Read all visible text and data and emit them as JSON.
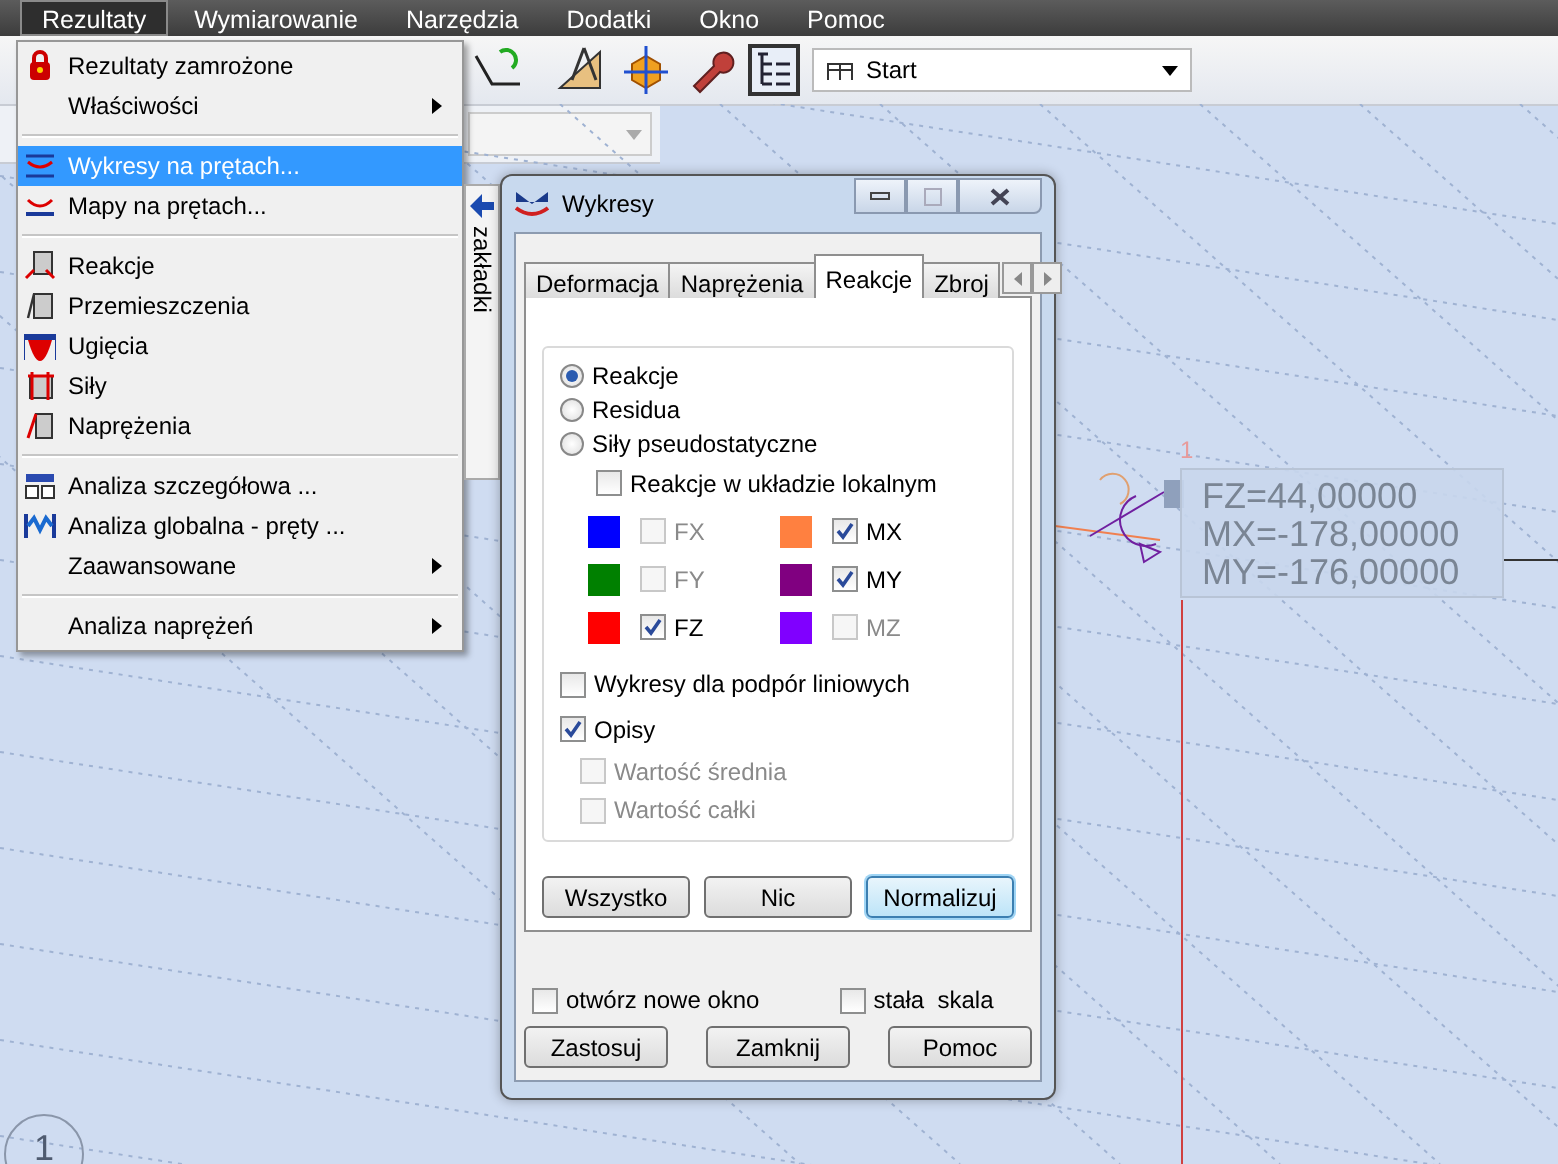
{
  "menu_bar": [
    {
      "label": "Rezultaty",
      "selected": true
    },
    {
      "label": "Wymiarowanie",
      "selected": false
    },
    {
      "label": "Narzędzia",
      "selected": false
    },
    {
      "label": "Dodatki",
      "selected": false
    },
    {
      "label": "Okno",
      "selected": false
    },
    {
      "label": "Pomoc",
      "selected": false
    }
  ],
  "toolbar": {
    "view_dropdown": {
      "value": "Start"
    }
  },
  "dropdown_menu": {
    "items": [
      {
        "kind": "item",
        "label": "Rezultaty zamrożone",
        "submenu": false,
        "selected": false
      },
      {
        "kind": "item",
        "label": "Właściwości",
        "submenu": true,
        "selected": false
      },
      {
        "kind": "separator"
      },
      {
        "kind": "item",
        "label": "Wykresy na prętach...",
        "submenu": false,
        "selected": true
      },
      {
        "kind": "item",
        "label": "Mapy na prętach...",
        "submenu": false,
        "selected": false
      },
      {
        "kind": "separator"
      },
      {
        "kind": "item",
        "label": "Reakcje",
        "submenu": false,
        "selected": false
      },
      {
        "kind": "item",
        "label": "Przemieszczenia",
        "submenu": false,
        "selected": false
      },
      {
        "kind": "item",
        "label": "Ugięcia",
        "submenu": false,
        "selected": false
      },
      {
        "kind": "item",
        "label": "Siły",
        "submenu": false,
        "selected": false
      },
      {
        "kind": "item",
        "label": "Naprężenia",
        "submenu": false,
        "selected": false
      },
      {
        "kind": "separator"
      },
      {
        "kind": "item",
        "label": "Analiza szczegółowa ...",
        "submenu": false,
        "selected": false
      },
      {
        "kind": "item",
        "label": "Analiza globalna - pręty ...",
        "submenu": false,
        "selected": false
      },
      {
        "kind": "item",
        "label": "Zaawansowane",
        "submenu": true,
        "selected": false
      },
      {
        "kind": "separator"
      },
      {
        "kind": "item",
        "label": "Analiza naprężeń",
        "submenu": true,
        "selected": false
      }
    ]
  },
  "side_tab": {
    "label": "zakładki"
  },
  "dialog": {
    "title": "Wykresy",
    "tabs": [
      {
        "label": "Deformacja",
        "selected": false
      },
      {
        "label": "Naprężenia",
        "selected": false
      },
      {
        "label": "Reakcje",
        "selected": true
      },
      {
        "label": "Zbroj",
        "selected": false
      }
    ],
    "radios": [
      {
        "label": "Reakcje",
        "selected": true
      },
      {
        "label": "Residua",
        "selected": false
      },
      {
        "label": "Siły pseudostatyczne",
        "selected": false
      }
    ],
    "local_system": {
      "label": "Reakcje w układzie lokalnym",
      "checked": false
    },
    "components": [
      {
        "label": "FX",
        "color": "#0000ff",
        "checked": false,
        "disabled": true
      },
      {
        "label": "MX",
        "color": "#ff8040",
        "checked": true,
        "disabled": false
      },
      {
        "label": "FY",
        "color": "#008000",
        "checked": false,
        "disabled": true
      },
      {
        "label": "MY",
        "color": "#800080",
        "checked": true,
        "disabled": false
      },
      {
        "label": "FZ",
        "color": "#ff0000",
        "checked": true,
        "disabled": false
      },
      {
        "label": "MZ",
        "color": "#8000ff",
        "checked": false,
        "disabled": true
      }
    ],
    "options": [
      {
        "label": "Wykresy dla podpór liniowych",
        "checked": false,
        "disabled": false,
        "indented": false
      },
      {
        "label": "Opisy",
        "checked": true,
        "disabled": false,
        "indented": false
      },
      {
        "label": "Wartość średnia",
        "checked": false,
        "disabled": true,
        "indented": true
      },
      {
        "label": "Wartość całki",
        "checked": false,
        "disabled": true,
        "indented": true
      }
    ],
    "panel_buttons": [
      {
        "label": "Wszystko",
        "focused": false
      },
      {
        "label": "Nic",
        "focused": false
      },
      {
        "label": "Normalizuj",
        "focused": true
      }
    ],
    "bottom_options": [
      {
        "label": "otwórz nowe okno",
        "checked": false
      },
      {
        "label": "stała  skala",
        "checked": false
      }
    ],
    "buttons": [
      {
        "label": "Zastosuj"
      },
      {
        "label": "Zamknij"
      },
      {
        "label": "Pomoc"
      }
    ]
  },
  "canvas": {
    "node_label": "1",
    "result_labels": [
      "FZ=44,00000",
      "MX=-178,00000",
      "MY=-176,00000"
    ],
    "corner_label": "1"
  }
}
